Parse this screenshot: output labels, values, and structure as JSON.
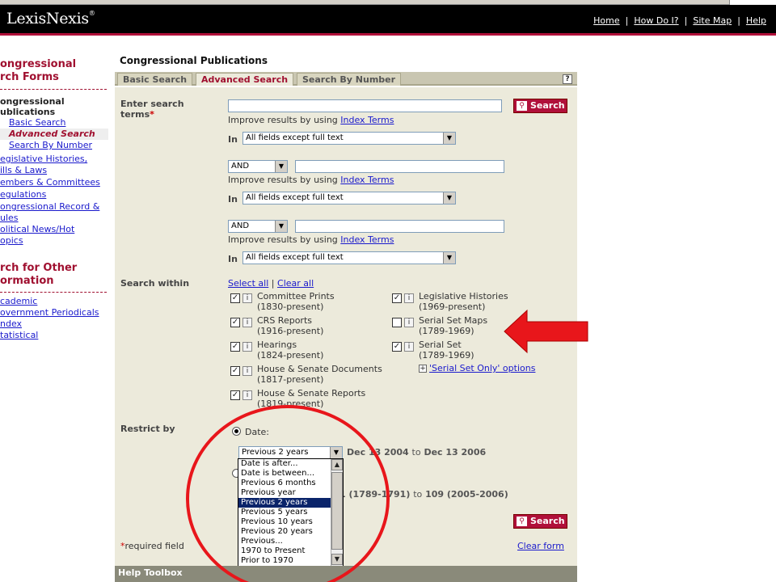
{
  "header": {
    "logo": "LexisNexis",
    "trademark": "®",
    "nav": [
      "Home",
      "How Do I?",
      "Site Map",
      "Help"
    ]
  },
  "leftnav": {
    "section1_title_l1": "ongressional",
    "section1_title_l2": "rch Forms",
    "sub_title_l1": "ongressional",
    "sub_title_l2": "ublications",
    "sub_items": [
      "Basic Search",
      "Advanced Search",
      "Search By Number"
    ],
    "items": [
      "egislative Histories,",
      "ills & Laws",
      "embers & Committees",
      "egulations",
      "ongressional Record &",
      "ules",
      "olitical News/Hot",
      "opics"
    ],
    "section2_title_l1": "rch for Other",
    "section2_title_l2": "ormation",
    "items2": [
      "cademic",
      "overnment Periodicals",
      "ndex",
      "tatistical"
    ]
  },
  "main": {
    "heading": "Congressional Publications",
    "tabs": [
      "Basic Search",
      "Advanced Search",
      "Search By Number"
    ],
    "help_q": "?",
    "enter_terms_l1": "Enter search",
    "enter_terms_l2": "terms",
    "required_star": "*",
    "search_label": "Search",
    "improve_text": "Improve results by using ",
    "index_terms": "Index Terms",
    "in_label": "In",
    "field_select": "All fields except full text",
    "connector": "AND",
    "search_within": "Search within",
    "select_all": "Select all",
    "pipe": "|",
    "clear_all": "Clear all",
    "sources_left": [
      {
        "name": "Committee Prints",
        "range": "(1830-present)",
        "checked": true
      },
      {
        "name": "CRS Reports",
        "range": "(1916-present)",
        "checked": true
      },
      {
        "name": "Hearings",
        "range": "(1824-present)",
        "checked": true
      },
      {
        "name": "House & Senate Documents",
        "range": "(1817-present)",
        "checked": true
      },
      {
        "name": "House & Senate Reports",
        "range": "(1819-present)",
        "checked": true
      }
    ],
    "sources_right": [
      {
        "name": "Legislative Histories",
        "range": "(1969-present)",
        "checked": true
      },
      {
        "name": "Serial Set Maps",
        "range": "(1789-1969)",
        "checked": false
      },
      {
        "name": "Serial Set",
        "range": "(1789-1969)",
        "checked": true
      }
    ],
    "serial_set_only": "'Serial Set Only' options",
    "restrict_by": "Restrict by",
    "date_label": "Date:",
    "date_select": "Previous 2 years",
    "date_range_from": "Dec 13 2004",
    "date_range_to_word": "to",
    "date_range_to": "Dec 13 2006",
    "congress_from": "(1789-1791)",
    "congress_to_word": "to",
    "congress_to": "109 (2005-2006)",
    "congress_prefix": "1",
    "required_field": "required field",
    "clear_form": "Clear form",
    "dropdown_options": [
      "Date is after...",
      "Date is between...",
      "Previous 6 months",
      "Previous year",
      "Previous 2 years",
      "Previous 5 years",
      "Previous 10 years",
      "Previous 20 years",
      "Previous...",
      "1970 to Present",
      "Prior to 1970"
    ],
    "dropdown_selected": "Previous 2 years",
    "help_toolbox": "Help Toolbox"
  },
  "annotations": {
    "arrow_color": "#e8161b",
    "circle_color": "#e8161b"
  }
}
